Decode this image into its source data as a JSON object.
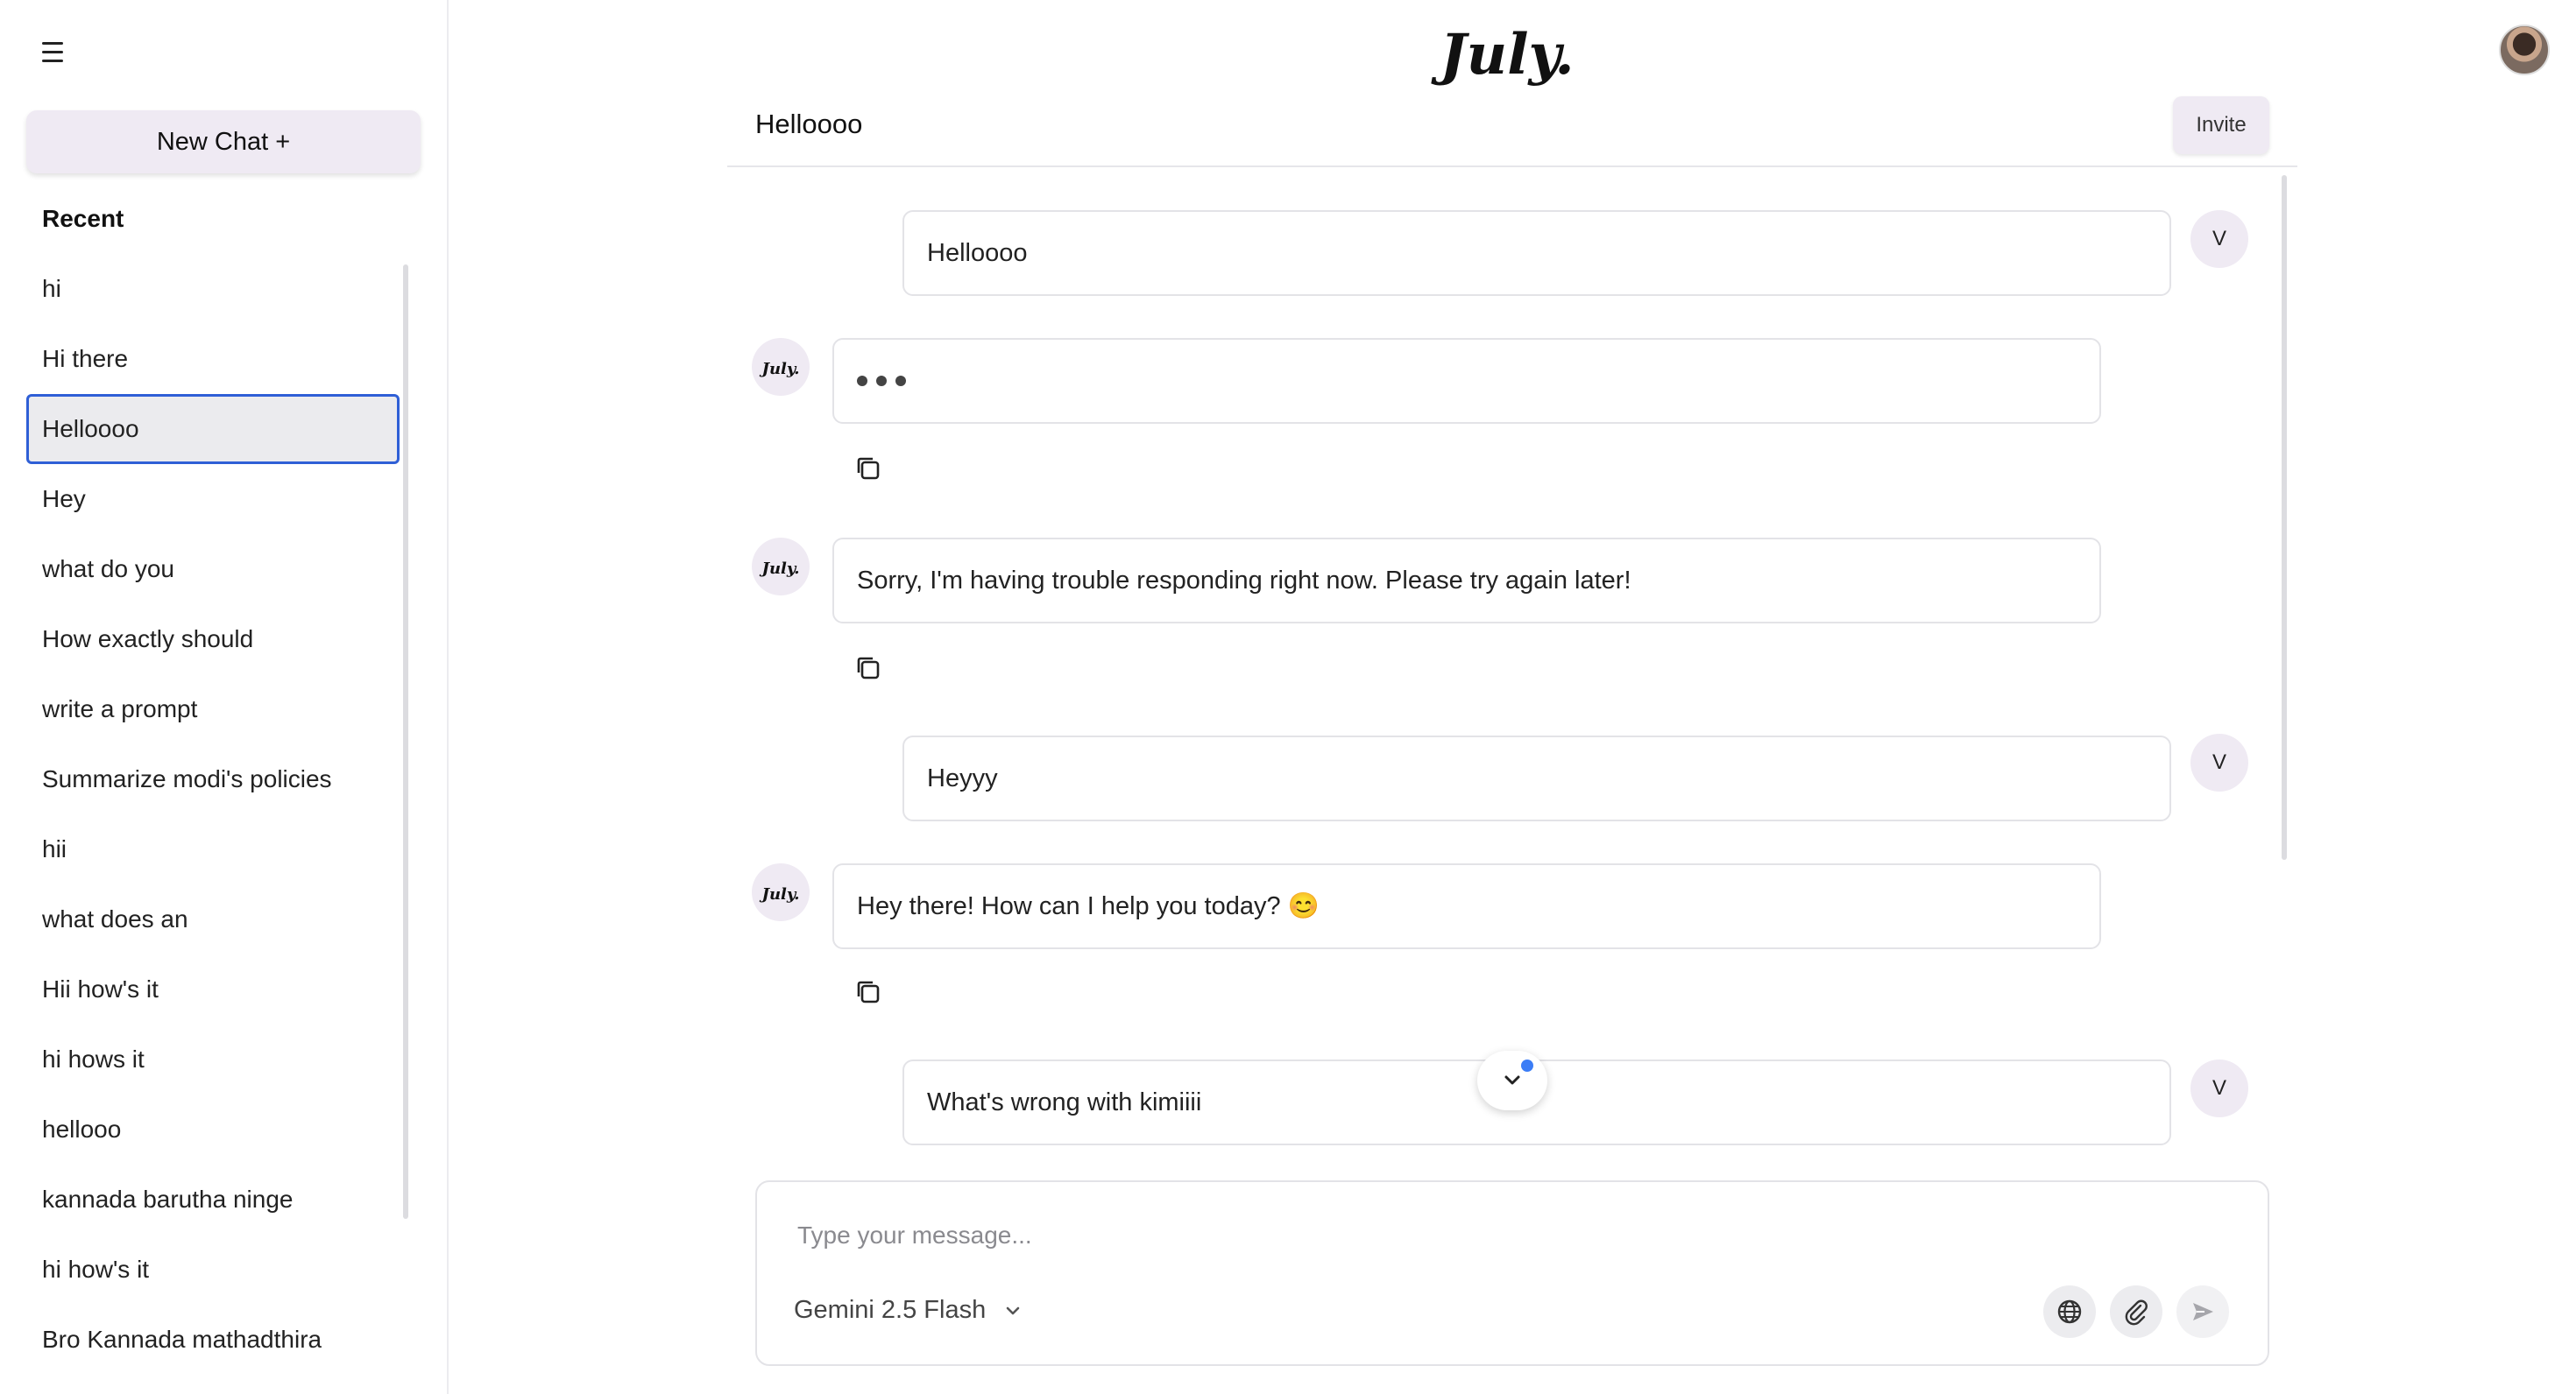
{
  "sidebar": {
    "new_chat_label": "New Chat +",
    "recent_heading": "Recent",
    "items": [
      {
        "label": "hi"
      },
      {
        "label": "Hi there"
      },
      {
        "label": "Helloooo"
      },
      {
        "label": "Hey"
      },
      {
        "label": "what do you"
      },
      {
        "label": "How exactly should"
      },
      {
        "label": "write a prompt"
      },
      {
        "label": "Summarize modi's policies"
      },
      {
        "label": "hii"
      },
      {
        "label": "what does an"
      },
      {
        "label": "Hii how's it"
      },
      {
        "label": "hi hows it"
      },
      {
        "label": "hellooo"
      },
      {
        "label": "kannada barutha ninge"
      },
      {
        "label": "hi how's it"
      },
      {
        "label": "Bro Kannada mathadthira"
      }
    ],
    "active_index": 2
  },
  "header": {
    "brand": "July.",
    "conversation_title": "Helloooo",
    "invite_label": "Invite"
  },
  "messages": [
    {
      "role": "user",
      "avatar": "V",
      "text": "Helloooo"
    },
    {
      "role": "assistant",
      "avatar": "July.",
      "typing": true,
      "text": ""
    },
    {
      "role": "assistant",
      "avatar": "July.",
      "text": "Sorry, I'm having trouble responding right now. Please try again later!"
    },
    {
      "role": "user",
      "avatar": "V",
      "text": "Heyyy"
    },
    {
      "role": "assistant",
      "avatar": "July.",
      "text": "Hey there! How can I help you today? 😊"
    },
    {
      "role": "user",
      "avatar": "V",
      "text": "What's wrong with kimiiii"
    }
  ],
  "composer": {
    "placeholder": "Type your message...",
    "value": "",
    "model_label": "Gemini 2.5 Flash",
    "icons": [
      "globe-icon",
      "paperclip-icon",
      "send-icon"
    ]
  },
  "colors": {
    "accent_bg": "#efeaf3",
    "active_border": "#2f5fd6",
    "notification_dot": "#3b7df6"
  }
}
